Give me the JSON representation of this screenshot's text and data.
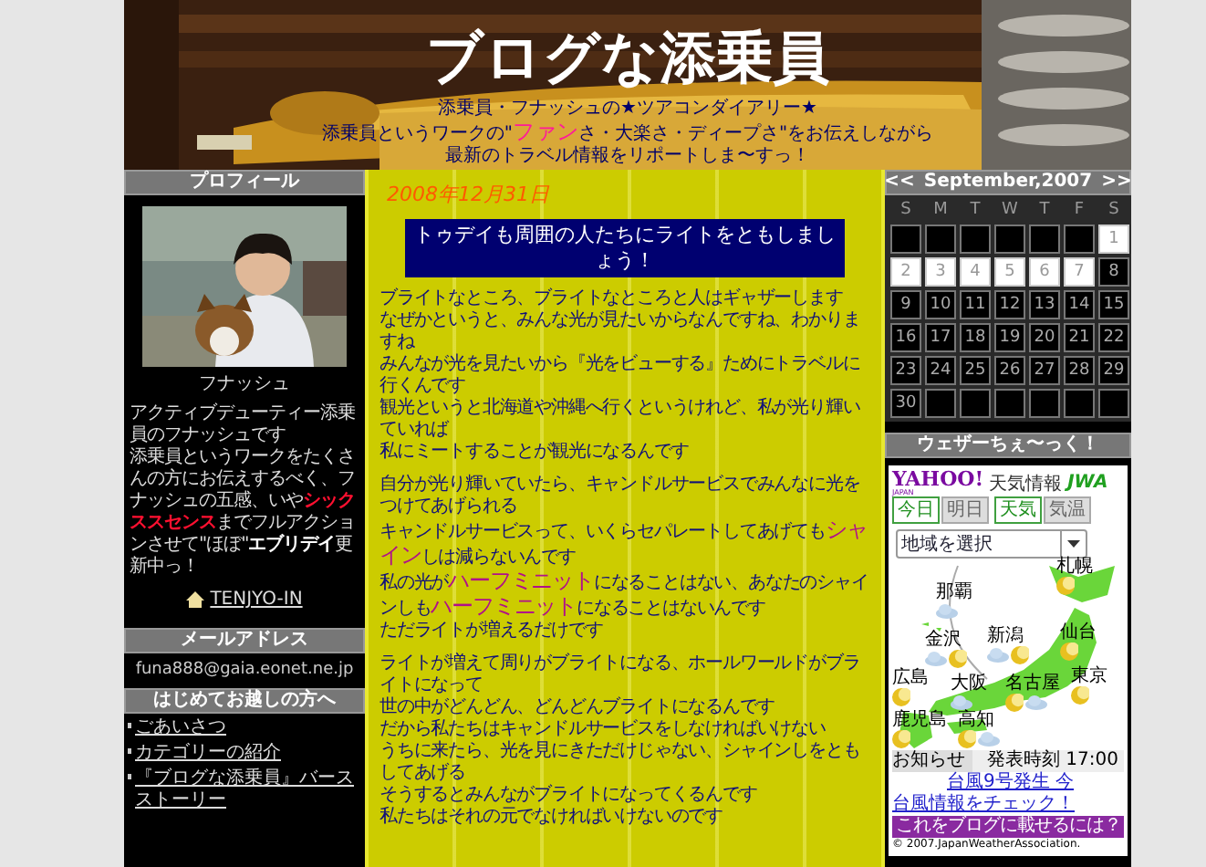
{
  "header": {
    "title": "ブログな添乗員",
    "tagline": [
      [
        {
          "kind": "plain",
          "text": "添乗員・フナッシュの★ツアコンダイアリー★"
        }
      ],
      [
        {
          "kind": "plain",
          "text": "添乗員というワークの\""
        },
        {
          "kind": "big",
          "text": "ファン"
        },
        {
          "kind": "plain",
          "text": "さ・大楽さ・ディープさ\"をお伝えしながら"
        }
      ],
      [
        {
          "kind": "plain",
          "text": "最新のトラベル情報をリポートしま〜すっ！"
        }
      ]
    ]
  },
  "left_sidebar": {
    "profile": {
      "heading": "プロフィール",
      "photo": {
        "kind": "picture"
      },
      "name": "フナッシュ",
      "bio": [
        "アクティブデューティー添乗員のフナッシュです",
        "添乗員というワークをたくさんの方にお伝えするべく、フナッシュの五感、いや**シックススセンス**までフルアクションさせて\"ほぼ\"**エブリデイ**更新中っ！"
      ],
      "link": "TENJYO-IN"
    },
    "mail": {
      "heading": "メールアドレス",
      "address": "funa888@gaia.eonet.ne.jp"
    },
    "intro": {
      "heading": "はじめてお越しの方へ",
      "links": [
        "ごあいさつ",
        "カテゴリーの紹介",
        "『ブログな添乗員』バースストーリー"
      ]
    }
  },
  "post": {
    "date": "2008年12月31日",
    "title": "トゥデイも周囲の人たちにライトをともしましょう！",
    "paragraphs": [
      [
        [
          {
            "kind": "plain",
            "text": "ブライトなところ、ブライトなところと人はギャザーします"
          }
        ],
        [
          {
            "kind": "plain",
            "text": "なぜかというと、みんな光が見たいからなんですね、わかりますね"
          }
        ],
        [
          {
            "kind": "plain",
            "text": "みんなが光を見たいから『光をビューする』ためにトラベルに行くんです"
          }
        ],
        [
          {
            "kind": "plain",
            "text": "観光というと北海道や沖縄へ行くというけれど、私が光り輝いていれば"
          }
        ],
        [
          {
            "kind": "plain",
            "text": "私にミートすることが観光になるんです"
          }
        ]
      ],
      [
        [
          {
            "kind": "plain",
            "text": "自分が光り輝いていたら、キャンドルサービスでみんなに光をつけてあげられる"
          }
        ],
        [
          {
            "kind": "plain",
            "text": "キャンドルサービスって、いくらセパレートしてあげても"
          },
          {
            "kind": "big",
            "text": "シャイン"
          },
          {
            "kind": "plain",
            "text": "しは減らないんです"
          }
        ],
        [
          {
            "kind": "plain",
            "text": "私の光が"
          },
          {
            "kind": "big",
            "text": "ハーフミニット"
          },
          {
            "kind": "plain",
            "text": "になることはない、あなたのシャインしも"
          },
          {
            "kind": "big",
            "text": "ハーフミニット"
          },
          {
            "kind": "plain",
            "text": "になることはないんです"
          }
        ],
        [
          {
            "kind": "plain",
            "text": "ただライトが増えるだけです"
          }
        ]
      ],
      [
        [
          {
            "kind": "plain",
            "text": "ライトが増えて周りがブライトになる、ホールワールドがブライトになって"
          }
        ],
        [
          {
            "kind": "plain",
            "text": "世の中がどんどん、どんどんブライトになるんです"
          }
        ],
        [
          {
            "kind": "plain",
            "text": "だから私たちはキャンドルサービスをしなければいけない"
          }
        ],
        [
          {
            "kind": "plain",
            "text": "うちに来たら、光を見にきただけじゃない、シャインしをともしてあげる"
          }
        ],
        [
          {
            "kind": "plain",
            "text": "そうするとみんながブライトになってくるんです"
          }
        ],
        [
          {
            "kind": "plain",
            "text": "私たちはそれの元でなければいけないのです"
          }
        ]
      ]
    ]
  },
  "calendar": {
    "prev": "<<",
    "month": "September,2007",
    "next": ">>",
    "weekdays": [
      "S",
      "M",
      "T",
      "W",
      "T",
      "F",
      "S"
    ],
    "weeks": [
      [
        {
          "kind": "blank"
        },
        {
          "kind": "blank"
        },
        {
          "kind": "blank"
        },
        {
          "kind": "blank"
        },
        {
          "kind": "blank"
        },
        {
          "kind": "blank"
        },
        {
          "kind": "day",
          "day": "1",
          "highlighted": true
        }
      ],
      [
        {
          "day": "2",
          "highlighted": true
        },
        {
          "day": "3",
          "highlighted": true
        },
        {
          "day": "4",
          "highlighted": true
        },
        {
          "day": "5",
          "highlighted": true
        },
        {
          "day": "6",
          "highlighted": true
        },
        {
          "day": "7",
          "highlighted": true
        },
        {
          "day": "8",
          "highlighted": false
        }
      ],
      [
        {
          "day": "9",
          "highlighted": false
        },
        {
          "day": "10",
          "highlighted": false
        },
        {
          "day": "11",
          "highlighted": false
        },
        {
          "day": "12",
          "highlighted": false
        },
        {
          "day": "13",
          "highlighted": false
        },
        {
          "day": "14",
          "highlighted": false
        },
        {
          "day": "15",
          "highlighted": false
        }
      ],
      [
        {
          "day": "16",
          "highlighted": false
        },
        {
          "day": "17",
          "highlighted": false
        },
        {
          "day": "18",
          "highlighted": false
        },
        {
          "day": "19",
          "highlighted": false
        },
        {
          "day": "20",
          "highlighted": false
        },
        {
          "day": "21",
          "highlighted": false
        },
        {
          "day": "22",
          "highlighted": false
        }
      ],
      [
        {
          "day": "23",
          "highlighted": false
        },
        {
          "day": "24",
          "highlighted": false
        },
        {
          "day": "25",
          "highlighted": false
        },
        {
          "day": "26",
          "highlighted": false
        },
        {
          "day": "27",
          "highlighted": false
        },
        {
          "day": "28",
          "highlighted": false
        },
        {
          "day": "29",
          "highlighted": false
        }
      ],
      [
        {
          "kind": "day",
          "day": "30",
          "highlighted": false
        },
        {
          "kind": "blank"
        },
        {
          "kind": "blank"
        },
        {
          "kind": "blank"
        },
        {
          "kind": "blank"
        },
        {
          "kind": "blank"
        },
        {
          "kind": "blank"
        }
      ]
    ]
  },
  "weather": {
    "heading": "ウェザーちぇ〜っく！",
    "logo": "YAHOO!",
    "logo_sub": "JAPAN",
    "service": "天気情報",
    "provider": "JWA",
    "day_tabs": [
      {
        "label": "今日",
        "selected": true
      },
      {
        "label": "明日",
        "selected": false
      }
    ],
    "mode_tabs": [
      {
        "label": "天気",
        "selected": true
      },
      {
        "label": "気温",
        "selected": false
      }
    ],
    "region_select": "地域を選択",
    "cities": [
      {
        "name": "札幌",
        "kind": "moon"
      },
      {
        "name": "那覇",
        "kind": "cloud"
      },
      {
        "name": "金沢",
        "kind": "cloud_moon"
      },
      {
        "name": "新潟",
        "kind": "cloud_moon"
      },
      {
        "name": "仙台",
        "kind": "moon"
      },
      {
        "name": "広島",
        "kind": "moon"
      },
      {
        "name": "大阪",
        "kind": "cloud"
      },
      {
        "name": "名古屋",
        "kind": "moon_cloud"
      },
      {
        "name": "東京",
        "kind": "moon"
      },
      {
        "name": "鹿児島",
        "kind": "moon"
      },
      {
        "name": "高知",
        "kind": "moon_cloud"
      }
    ],
    "notice_label": "お知らせ",
    "issued": "発表時刻 17:00",
    "ticker": "台風9号発生 今",
    "link": "台風情報をチェック！",
    "embed_button": "これをブログに載せるには？",
    "copyright": "© 2007.JapanWeatherAssociation."
  }
}
